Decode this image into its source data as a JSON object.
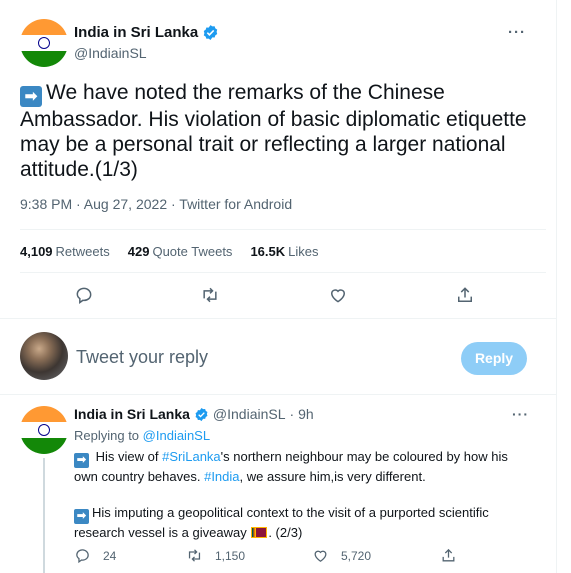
{
  "main_tweet": {
    "author_name": "India in Sri Lanka",
    "handle": "@IndiainSL",
    "text": "We have noted the remarks of the Chinese Ambassador. His violation of basic diplomatic etiquette may be a personal trait or reflecting a larger national attitude.(1/3)",
    "timestamp": "9:38 PM · Aug 27, 2022 · Twitter for Android",
    "stats": {
      "retweets_count": "4,109",
      "retweets_label": "Retweets",
      "quotes_count": "429",
      "quotes_label": "Quote Tweets",
      "likes_count": "16.5K",
      "likes_label": "Likes"
    },
    "actions": [
      "reply",
      "retweet",
      "like",
      "share"
    ]
  },
  "compose": {
    "placeholder": "Tweet your reply",
    "button_label": "Reply"
  },
  "reply_tweet": {
    "author_name": "India in Sri Lanka",
    "handle": "@IndiainSL",
    "time": "· 9h",
    "replying_prefix": "Replying to",
    "replying_handle": "@IndiainSL",
    "para1_a": "His view of",
    "para1_tag1": "#SriLanka",
    "para1_b": "'s northern neighbour may be coloured by how his own country behaves.",
    "para1_tag2": "#India",
    "para1_c": ", we assure him,is very different.",
    "para2_a": "His imputing a geopolitical context to the visit of a purported scientific research vessel is a giveaway",
    "para2_b": ". (2/3)",
    "reply_count": "24",
    "retweet_count": "1,150",
    "like_count": "5,720"
  },
  "colors": {
    "accent": "#1d9bf0",
    "reply_button_disabled": "#8ecdf7",
    "secondary_text": "#536471"
  }
}
